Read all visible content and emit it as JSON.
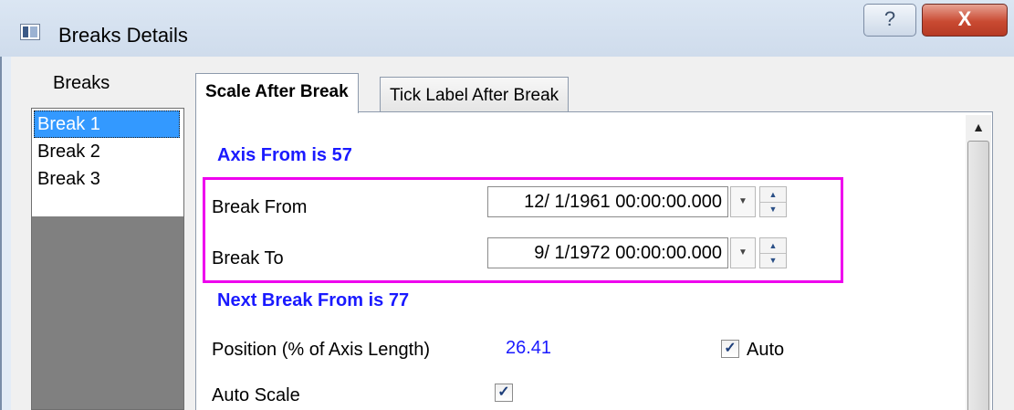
{
  "window": {
    "title": "Breaks Details",
    "help_glyph": "?",
    "close_glyph": "X"
  },
  "breaks_panel": {
    "header": "Breaks",
    "items": [
      {
        "label": "Break 1",
        "selected": true
      },
      {
        "label": "Break 2",
        "selected": false
      },
      {
        "label": "Break 3",
        "selected": false
      }
    ]
  },
  "tabs": [
    {
      "label": "Scale After Break",
      "active": true
    },
    {
      "label": "Tick Label After Break",
      "active": false
    }
  ],
  "scale_tab": {
    "axis_from": "Axis From is 57",
    "break_from": {
      "label": "Break From",
      "value": "12/  1/1961 00:00:00.000"
    },
    "break_to": {
      "label": "Break To",
      "value": "9/  1/1972 00:00:00.000"
    },
    "next_break_from": "Next Break From is 77",
    "position": {
      "label": "Position (% of Axis Length)",
      "value": "26.41",
      "auto_label": "Auto",
      "auto_checked": true
    },
    "auto_scale": {
      "label": "Auto Scale",
      "checked": true
    }
  },
  "icons": {
    "check": "✓",
    "dropdown": "▼",
    "spin_up": "▲",
    "spin_down": "▼",
    "scroll_up": "▲"
  },
  "colors": {
    "selection": "#3399ff",
    "info_text": "#1a1aff",
    "highlight_box": "#ee00ee",
    "close_button": "#c94a32"
  }
}
